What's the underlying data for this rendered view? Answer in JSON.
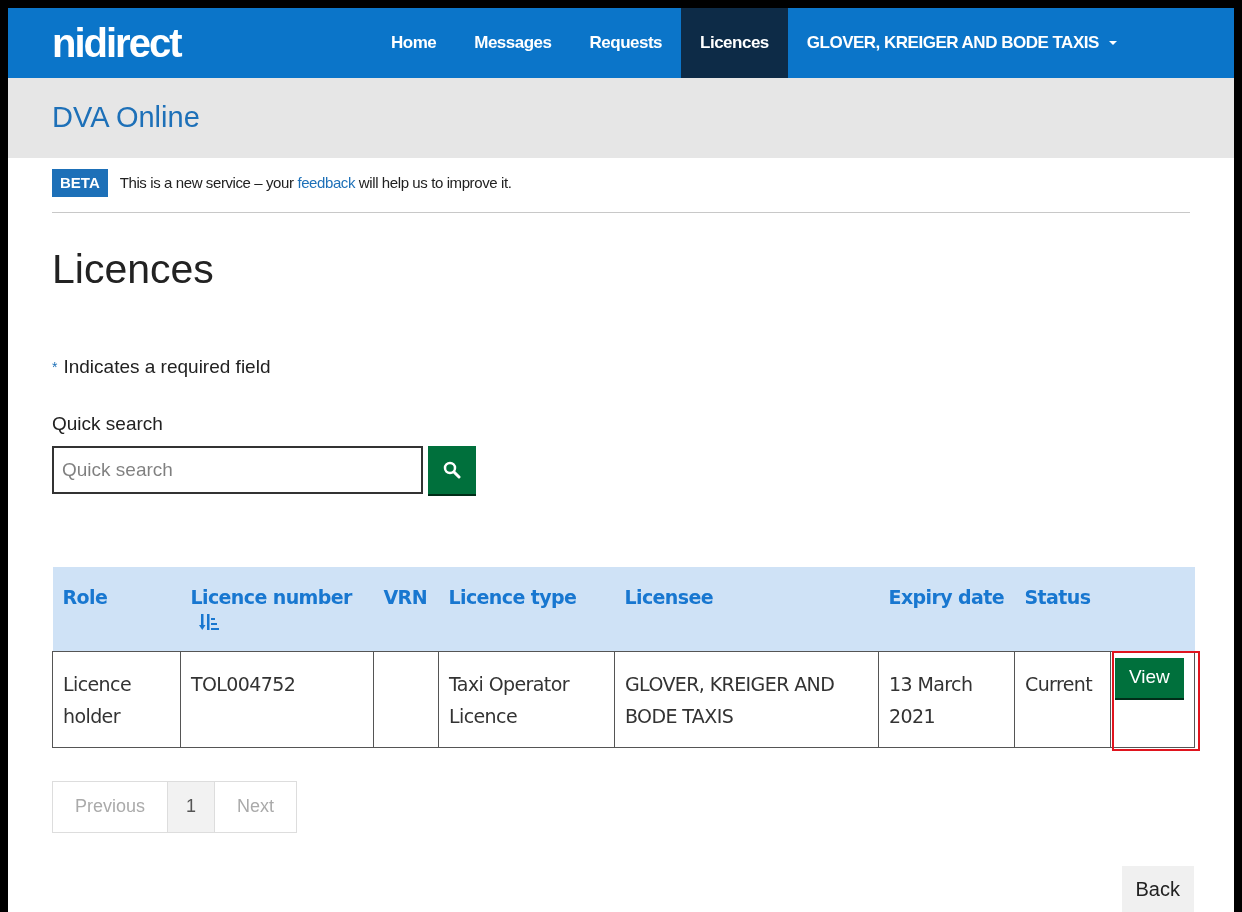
{
  "header": {
    "logo": "nidirect",
    "nav": [
      {
        "label": "Home",
        "selected": false,
        "kind": "link"
      },
      {
        "label": "Messages",
        "selected": false,
        "kind": "link"
      },
      {
        "label": "Requests",
        "selected": false,
        "kind": "link"
      },
      {
        "label": "Licences",
        "selected": true,
        "kind": "link"
      },
      {
        "label": "GLOVER, KREIGER AND BODE TAXIS",
        "selected": false,
        "kind": "dropdown"
      }
    ]
  },
  "service_title": "DVA Online",
  "beta_banner": {
    "tag": "BETA",
    "message_before": "This is a new service – your",
    "link": "feedback",
    "message_after": "will help us to improve it."
  },
  "page_title": "Licences",
  "required_note": {
    "marker": "*",
    "text": "Indicates a required field"
  },
  "quick_search": {
    "label": "Quick search",
    "placeholder": "Quick search"
  },
  "table": {
    "columns": [
      {
        "label": "Role",
        "sortable": false
      },
      {
        "label": "Licence number",
        "sortable": true
      },
      {
        "label": "VRN",
        "sortable": false
      },
      {
        "label": "Licence type",
        "sortable": false
      },
      {
        "label": "Licensee",
        "sortable": false
      },
      {
        "label": "Expiry date",
        "sortable": false
      },
      {
        "label": "Status",
        "sortable": false
      }
    ],
    "rows": [
      {
        "cells": [
          "Licence holder",
          "TOL004752",
          "",
          "Taxi Operator Licence",
          "GLOVER, KREIGER AND BODE TAXIS",
          "13 March 2021",
          "Current"
        ],
        "action": "View",
        "highlighted": true
      }
    ]
  },
  "pagination": [
    {
      "label": "Previous",
      "kind": "prev",
      "disabled": true
    },
    {
      "label": "1",
      "kind": "page",
      "selected": true
    },
    {
      "label": "Next",
      "kind": "next",
      "disabled": true
    }
  ],
  "back_button": "Back"
}
